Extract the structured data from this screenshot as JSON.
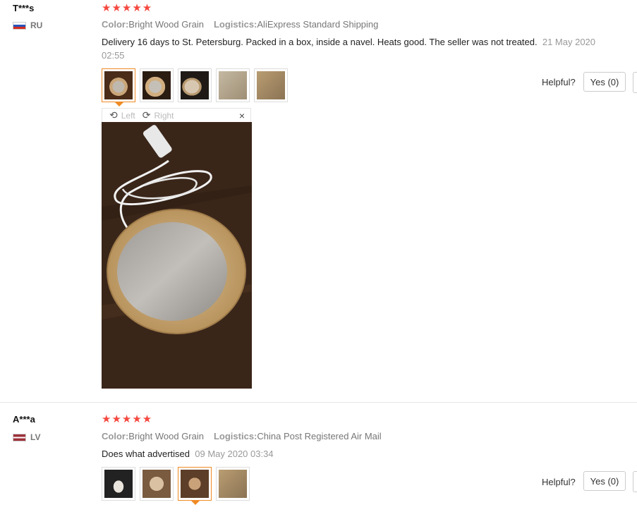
{
  "reviews": [
    {
      "user": "T***s",
      "country": "RU",
      "stars": "★★★★★",
      "color_label": "Color:",
      "color_value": "Bright Wood Grain",
      "logistics_label": "Logistics:",
      "logistics_value": "AliExpress Standard Shipping",
      "text": "Delivery 16 days to St. Petersburg. Packed in a box, inside a navel. Heats good. The seller was not treated.",
      "date": "21 May 2020 02:55",
      "viewer": {
        "left": "Left",
        "right": "Right",
        "close": "×"
      },
      "helpful": "Helpful?",
      "yes": "Yes (0)"
    },
    {
      "user": "A***a",
      "country": "LV",
      "stars": "★★★★★",
      "color_label": "Color:",
      "color_value": "Bright Wood Grain",
      "logistics_label": "Logistics:",
      "logistics_value": "China Post Registered Air Mail",
      "text": "Does what advertised",
      "date": "09 May 2020 03:34",
      "helpful": "Helpful?",
      "yes": "Yes (0)"
    }
  ],
  "icons": {
    "rotate_left": "rotate-left-icon",
    "rotate_right": "rotate-right-icon",
    "close": "close-icon"
  },
  "colors": {
    "stars": "#f5483f",
    "active_thumb": "#f08a24"
  }
}
